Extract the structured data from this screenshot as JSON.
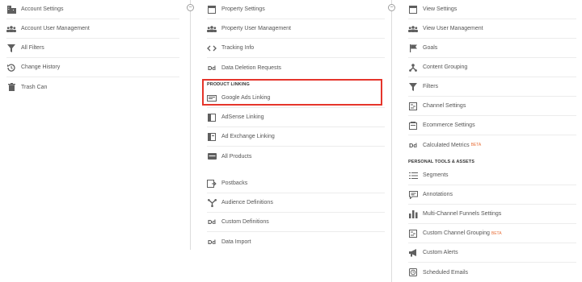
{
  "account": {
    "items": [
      {
        "label": "Account Settings",
        "icon": "building-icon"
      },
      {
        "label": "Account User Management",
        "icon": "users-icon"
      },
      {
        "label": "All Filters",
        "icon": "filter-icon"
      },
      {
        "label": "Change History",
        "icon": "history-icon"
      },
      {
        "label": "Trash Can",
        "icon": "trash-icon"
      }
    ]
  },
  "property": {
    "items": [
      {
        "label": "Property Settings",
        "icon": "property-settings-icon"
      },
      {
        "label": "Property User Management",
        "icon": "users-icon"
      },
      {
        "label": "Tracking Info",
        "icon": "code-icon"
      },
      {
        "label": "Data Deletion Requests",
        "icon": "dd-icon",
        "glyph": "Dd"
      }
    ],
    "section_label": "PRODUCT LINKING",
    "linking": [
      {
        "label": "Google Ads Linking",
        "icon": "google-ads-icon"
      },
      {
        "label": "AdSense Linking",
        "icon": "adsense-icon"
      },
      {
        "label": "Ad Exchange Linking",
        "icon": "ad-exchange-icon"
      },
      {
        "label": "All Products",
        "icon": "all-products-icon"
      }
    ],
    "more": [
      {
        "label": "Postbacks",
        "icon": "postbacks-icon"
      },
      {
        "label": "Audience Definitions",
        "icon": "audience-icon"
      },
      {
        "label": "Custom Definitions",
        "icon": "dd-icon",
        "glyph": "Dd"
      },
      {
        "label": "Data Import",
        "icon": "dd-icon",
        "glyph": "Dd"
      }
    ]
  },
  "view": {
    "items": [
      {
        "label": "View Settings",
        "icon": "view-settings-icon"
      },
      {
        "label": "View User Management",
        "icon": "users-icon"
      },
      {
        "label": "Goals",
        "icon": "flag-icon"
      },
      {
        "label": "Content Grouping",
        "icon": "content-grouping-icon"
      },
      {
        "label": "Filters",
        "icon": "filter-icon"
      },
      {
        "label": "Channel Settings",
        "icon": "channel-settings-icon"
      },
      {
        "label": "Ecommerce Settings",
        "icon": "cart-icon"
      },
      {
        "label": "Calculated Metrics",
        "icon": "dd-icon",
        "glyph": "Dd",
        "badge": "BETA"
      }
    ],
    "section_label": "PERSONAL TOOLS & ASSETS",
    "personal": [
      {
        "label": "Segments",
        "icon": "segments-icon"
      },
      {
        "label": "Annotations",
        "icon": "annotations-icon"
      },
      {
        "label": "Multi-Channel Funnels Settings",
        "icon": "bar-chart-icon"
      },
      {
        "label": "Custom Channel Grouping",
        "icon": "channel-grouping-icon",
        "badge": "BETA"
      },
      {
        "label": "Custom Alerts",
        "icon": "megaphone-icon"
      },
      {
        "label": "Scheduled Emails",
        "icon": "clock-icon"
      }
    ]
  },
  "colors": {
    "highlight": "#e5352b",
    "beta": "#e8703a",
    "icon": "#5f5f5f"
  },
  "collapse_glyph": "⊖"
}
